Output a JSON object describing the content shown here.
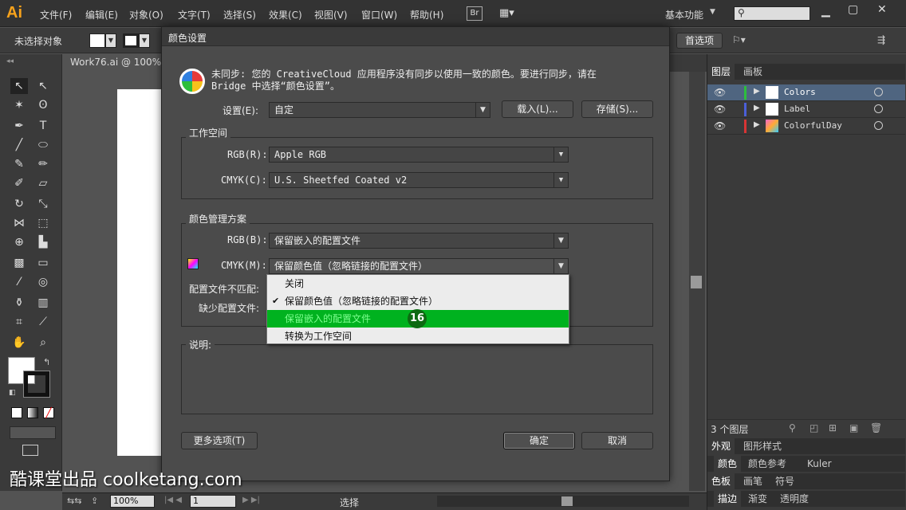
{
  "app": {
    "logo": "Ai"
  },
  "menu": [
    "文件(F)",
    "编辑(E)",
    "对象(O)",
    "文字(T)",
    "选择(S)",
    "效果(C)",
    "视图(V)",
    "窗口(W)",
    "帮助(H)"
  ],
  "menubar": {
    "bridge": "Br",
    "workspace": "基本功能",
    "search_placeholder": ""
  },
  "control_bar": {
    "status": "未选择对象",
    "prefs_button": "首选项"
  },
  "document_tab": "Work76.ai @ 100%",
  "dialog": {
    "title": "颜色设置",
    "sync_message_line1": "未同步: 您的 CreativeCloud 应用程序没有同步以使用一致的颜色。要进行同步，请在",
    "sync_message_line2": "Bridge 中选择“颜色设置”。",
    "settings_label": "设置(E):",
    "settings_value": "自定",
    "load_button": "载入(L)...",
    "save_button": "存储(S)...",
    "workspace_group": "工作空间",
    "rgb_label": "RGB(R):",
    "rgb_value": "Apple RGB",
    "cmyk_label": "CMYK(C):",
    "cmyk_value": "U.S. Sheetfed Coated v2",
    "policy_group": "颜色管理方案",
    "policy_rgb_label": "RGB(B):",
    "policy_rgb_value": "保留嵌入的配置文件",
    "policy_cmyk_label": "CMYK(M):",
    "policy_cmyk_value": "保留颜色值（忽略链接的配置文件）",
    "mismatch_label": "配置文件不匹配:",
    "missing_label": "缺少配置文件:",
    "description_label": "说明:",
    "more_options_button": "更多选项(T)",
    "ok_button": "确定",
    "cancel_button": "取消"
  },
  "dropdown": {
    "items": [
      "关闭",
      "保留颜色值（忽略链接的配置文件）",
      "保留嵌入的配置文件",
      "转换为工作空间"
    ],
    "checked_index": 1,
    "highlighted_index": 2,
    "step_badge": "16",
    "highlight_color": "#00b21f"
  },
  "layers_panel": {
    "tabs": [
      "图层",
      "画板"
    ],
    "layers": [
      {
        "name": "Colors",
        "color": "#2dbe3c"
      },
      {
        "name": "Label",
        "color": "#4b5fd8"
      },
      {
        "name": "ColorfulDay",
        "color": "#d83434"
      }
    ],
    "footer_count": "3 个图层"
  },
  "right_panels": {
    "row1": [
      "外观",
      "图形样式"
    ],
    "row2": [
      "颜色",
      "颜色参考",
      "Kuler"
    ],
    "row3": [
      "色板",
      "画笔",
      "符号"
    ],
    "row4": [
      "描边",
      "渐变",
      "透明度"
    ]
  },
  "statusbar": {
    "zoom": "100%",
    "page": "1",
    "status_text": "选择"
  },
  "watermark": "酷课堂出品 coolketang.com"
}
